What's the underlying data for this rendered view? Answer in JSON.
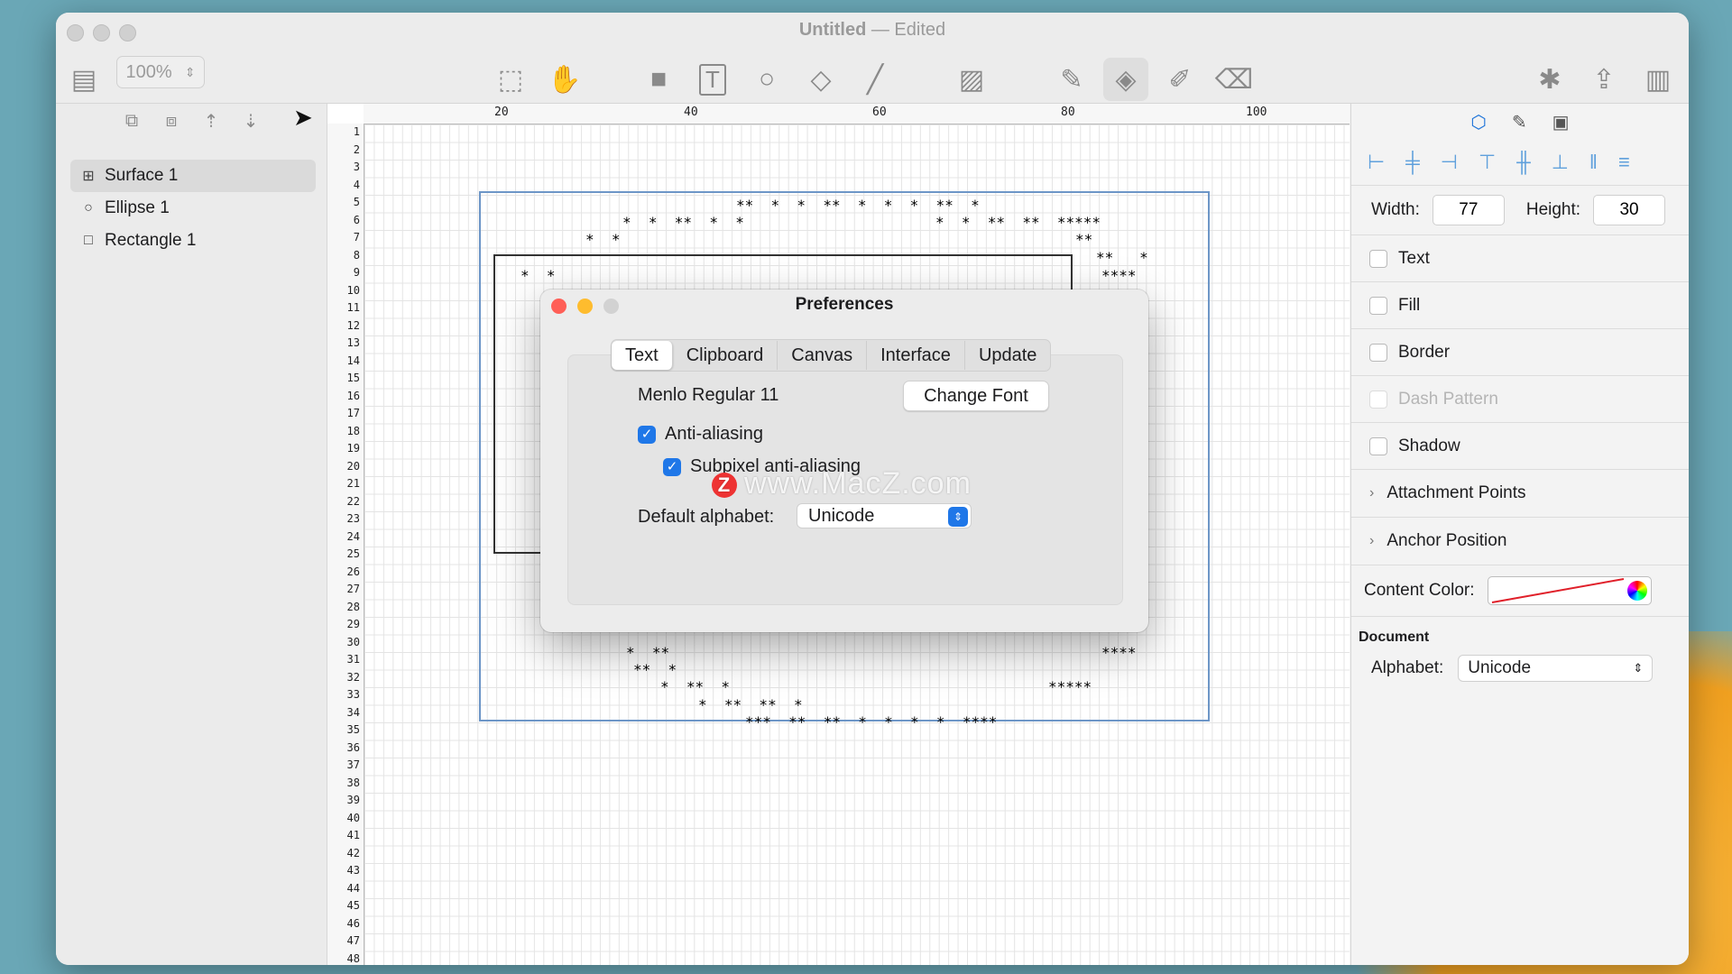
{
  "window": {
    "title": "Untitled",
    "title_suffix": "— Edited"
  },
  "toolbar": {
    "zoom": "100%"
  },
  "layers": [
    {
      "label": "Surface 1",
      "icon": "grid-icon"
    },
    {
      "label": "Ellipse 1",
      "icon": "circle-icon"
    },
    {
      "label": "Rectangle 1",
      "icon": "square-icon"
    }
  ],
  "ruler": {
    "top_ticks": [
      "20",
      "40",
      "60",
      "80",
      "100"
    ],
    "left_rows": [
      "1",
      "2",
      "3",
      "4",
      "5",
      "6",
      "7",
      "8",
      "9",
      "10",
      "11",
      "12",
      "13",
      "14",
      "15",
      "16",
      "17",
      "18",
      "19",
      "20",
      "21",
      "22",
      "23",
      "24",
      "25",
      "26",
      "27",
      "28",
      "29",
      "30",
      "31",
      "32",
      "33",
      "34",
      "35",
      "36",
      "37",
      "38",
      "39",
      "40",
      "41",
      "42",
      "43",
      "44",
      "45",
      "46",
      "47",
      "48"
    ]
  },
  "canvas": {
    "ascii_lines": [
      "**  *  *  **  *  *  *  **  *",
      "*  *  **  *  *",
      "*  *  **  **  *****",
      "*  *",
      "**",
      "**   *",
      "*  *",
      "****",
      "**",
      "*  **",
      "**  *",
      "****",
      "*  **  *",
      "*****",
      "*  **  **  *",
      "***  **  **  *  *  *  *  ****"
    ]
  },
  "inspector": {
    "width_label": "Width:",
    "width_value": "77",
    "height_label": "Height:",
    "height_value": "30",
    "checks": [
      "Text",
      "Fill",
      "Border",
      "Dash Pattern",
      "Shadow"
    ],
    "disclosures": [
      "Attachment Points",
      "Anchor Position"
    ],
    "content_color_label": "Content Color:",
    "document_title": "Document",
    "alphabet_label": "Alphabet:",
    "alphabet_value": "Unicode"
  },
  "dialog": {
    "title": "Preferences",
    "tabs": [
      "Text",
      "Clipboard",
      "Canvas",
      "Interface",
      "Update"
    ],
    "active_tab": "Text",
    "font_name": "Menlo Regular 11",
    "change_font": "Change Font",
    "anti_aliasing": "Anti-aliasing",
    "subpixel": "Subpixel anti-aliasing",
    "alphabet_label": "Default alphabet:",
    "alphabet_value": "Unicode"
  },
  "watermark": "www.MacZ.com",
  "colors": {
    "accent": "#1f77e8",
    "close": "#ff5f57",
    "minimize": "#febc2e",
    "zoom": "#d2d2d2"
  }
}
